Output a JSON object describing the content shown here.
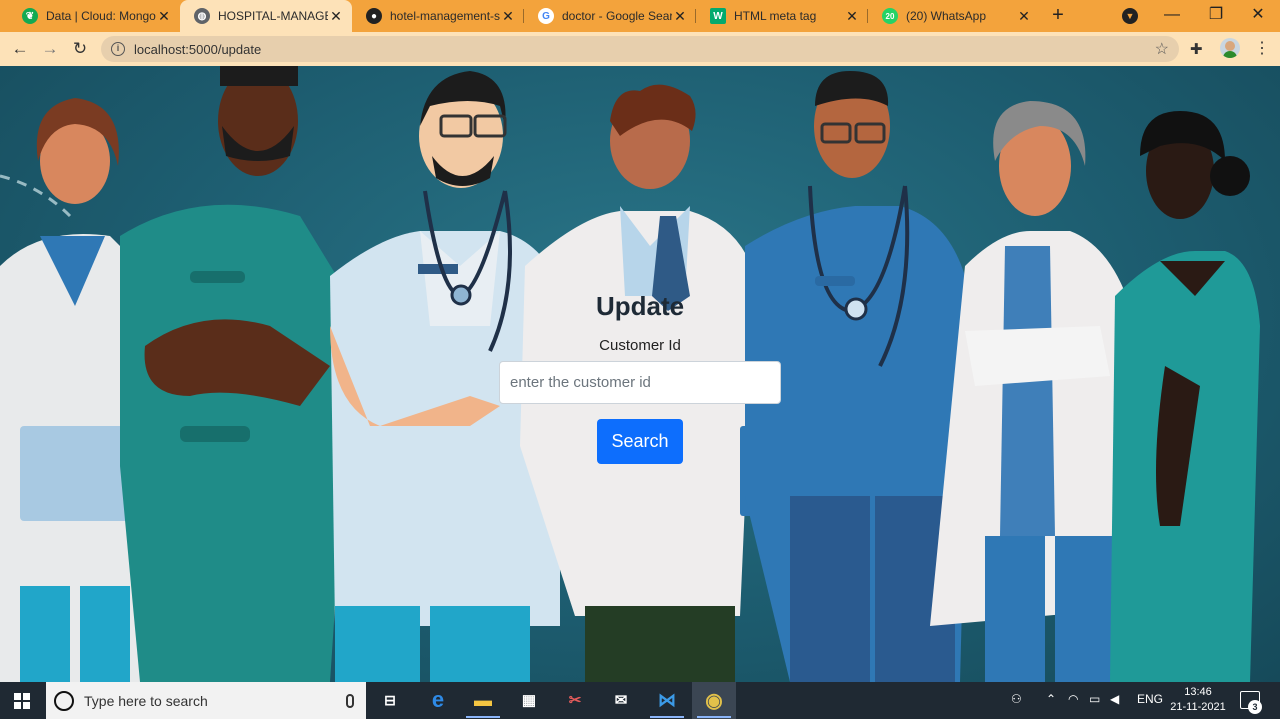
{
  "browser": {
    "tabs": [
      {
        "label": "Data | Cloud: MongoD",
        "icon": "mongodb-leaf-icon",
        "color": "#13aa52"
      },
      {
        "label": "HOSPITAL-MANAGEM",
        "icon": "globe-icon",
        "color": "#5f6368",
        "active": true
      },
      {
        "label": "hotel-management-sy",
        "icon": "github-icon",
        "color": "#222222"
      },
      {
        "label": "doctor - Google Searc",
        "icon": "google-icon",
        "color": "#4285f4"
      },
      {
        "label": "HTML meta tag",
        "icon": "w3schools-icon",
        "color": "#04aa6d"
      },
      {
        "label": "(20) WhatsApp",
        "icon": "whatsapp-icon",
        "color": "#25d366",
        "badge": "20"
      }
    ],
    "url": "localhost:5000/update",
    "accent": "#f3a33c",
    "toolbar_color": "#fde2b8"
  },
  "page": {
    "title": "Update",
    "field_label": "Customer Id",
    "input": {
      "value": "",
      "placeholder": "enter the customer id"
    },
    "button_label": "Search",
    "button_color": "#0d6efd"
  },
  "taskbar": {
    "search_placeholder": "Type here to search",
    "tray": {
      "language": "ENG",
      "time": "13:46",
      "date": "21-11-2021",
      "notifications": "3"
    }
  }
}
